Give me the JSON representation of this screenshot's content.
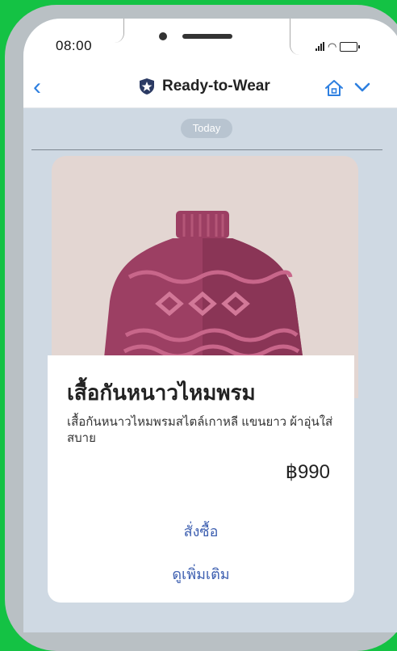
{
  "status_bar": {
    "time": "08:00"
  },
  "nav": {
    "title": "Ready-to-Wear"
  },
  "chat": {
    "date_label": "Today"
  },
  "product": {
    "title": "เสื้อกันหนาวไหมพรม",
    "description": "เสื้อกันหนาวไหมพรมสไตล์เกาหลี แขนยาว ผ้าอุ่นใส่สบาย",
    "price": "฿990",
    "buttons": {
      "order": "สั่งซื้อ",
      "more": "ดูเพิ่มเติม"
    },
    "image_icon": "sweater-illustration"
  },
  "colors": {
    "background": "#14c244",
    "accent": "#2d7fe0",
    "link": "#3d5fb0",
    "sweater": "#9c3f63"
  }
}
